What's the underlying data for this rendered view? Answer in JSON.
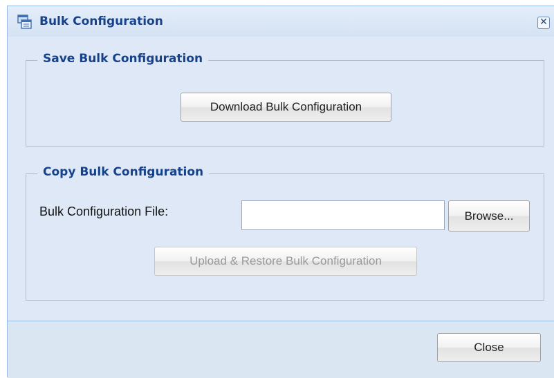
{
  "dialog": {
    "title": "Bulk Configuration",
    "close_icon_glyph": "✕",
    "icon": "dialog-window-icon"
  },
  "save_section": {
    "legend": "Save Bulk Configuration",
    "download_button": "Download Bulk Configuration"
  },
  "copy_section": {
    "legend": "Copy Bulk Configuration",
    "file_label": "Bulk Configuration File:",
    "file_value": "",
    "browse_button": "Browse...",
    "upload_button": "Upload & Restore Bulk Configuration"
  },
  "footer": {
    "close_button": "Close"
  },
  "colors": {
    "title_text": "#15428b",
    "panel_bg": "#dfe8f6",
    "border": "#99bbe8"
  }
}
